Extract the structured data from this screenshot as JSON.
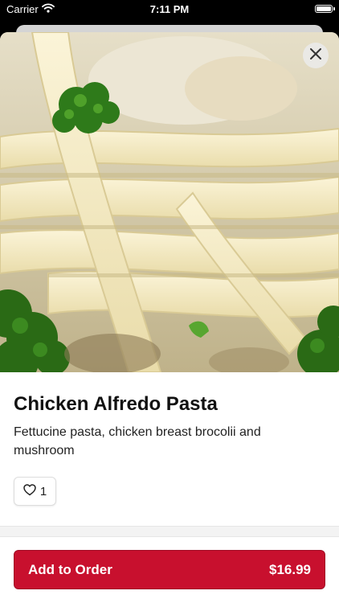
{
  "status_bar": {
    "carrier": "Carrier",
    "time": "7:11 PM"
  },
  "item": {
    "name": "Chicken Alfredo Pasta",
    "description": "Fettucine pasta, chicken breast brocolii and mushroom",
    "likes": "1",
    "image": "chicken alfredo pasta photo"
  },
  "order": {
    "label": "Add to Order",
    "price": "$16.99"
  },
  "colors": {
    "accent": "#c8102e",
    "background": "#ffffff"
  },
  "icons": {
    "close": "close-icon",
    "like": "heart-icon",
    "wifi": "wifi-icon",
    "battery": "battery-icon"
  }
}
